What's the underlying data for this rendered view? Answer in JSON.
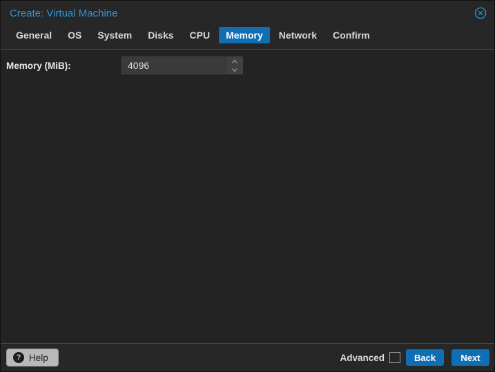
{
  "window": {
    "title": "Create: Virtual Machine"
  },
  "tabs": [
    {
      "label": "General",
      "active": false
    },
    {
      "label": "OS",
      "active": false
    },
    {
      "label": "System",
      "active": false
    },
    {
      "label": "Disks",
      "active": false
    },
    {
      "label": "CPU",
      "active": false
    },
    {
      "label": "Memory",
      "active": true
    },
    {
      "label": "Network",
      "active": false
    },
    {
      "label": "Confirm",
      "active": false
    }
  ],
  "form": {
    "memory_label": "Memory (MiB):",
    "memory_value": "4096"
  },
  "footer": {
    "help_label": "Help",
    "help_icon_glyph": "?",
    "advanced_label": "Advanced",
    "advanced_checked": false,
    "back_label": "Back",
    "next_label": "Next"
  },
  "colors": {
    "accent_blue": "#0f6eb4",
    "title_blue": "#3094d8",
    "close_icon_blue": "#2196d4",
    "header_bg": "#272727",
    "content_bg": "#232323",
    "field_bg": "#3a3a3a",
    "help_btn_bg": "#b9b9b9"
  }
}
